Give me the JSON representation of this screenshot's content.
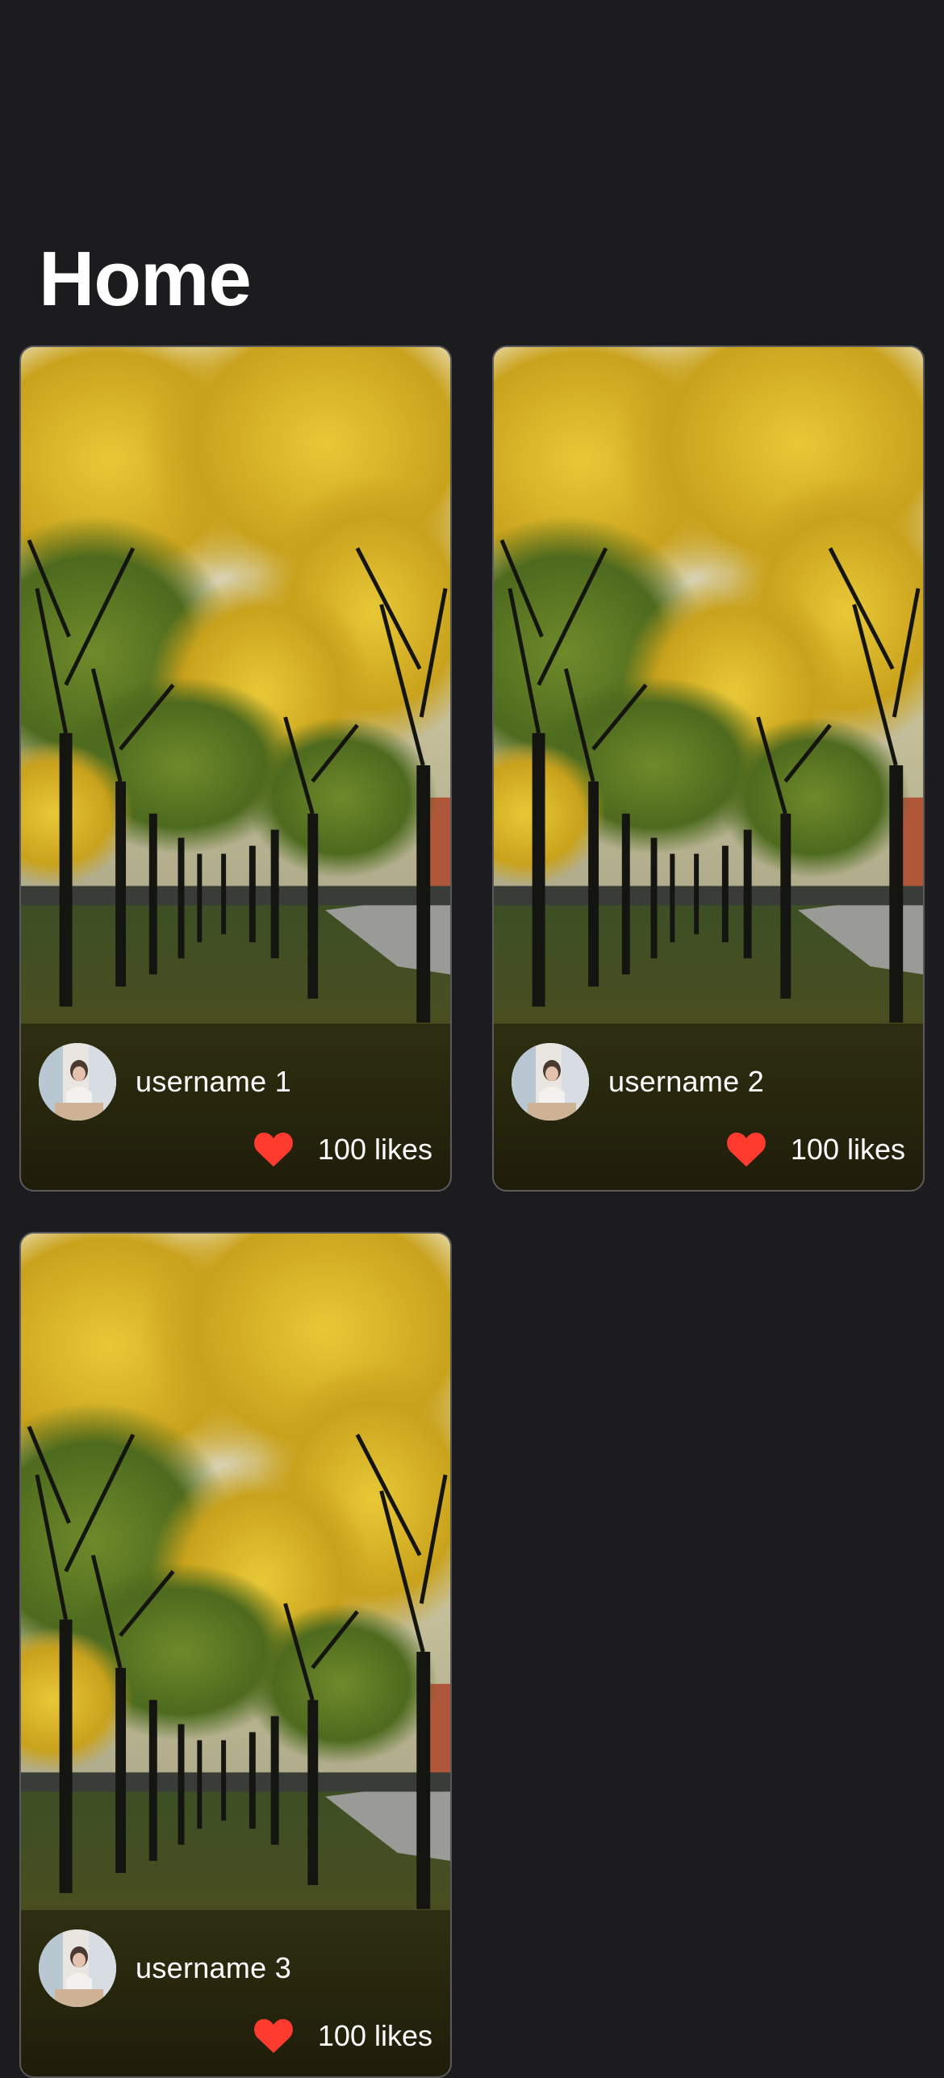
{
  "page": {
    "title": "Home"
  },
  "colors": {
    "background": "#1c1c1e",
    "card_border": "#5a5a5e",
    "heart": "#ff3b30",
    "text": "#ffffff"
  },
  "icons": {
    "like": "heart-icon",
    "avatar": "avatar-photo"
  },
  "posts": [
    {
      "username": "username 1",
      "likes": "100 likes"
    },
    {
      "username": "username 2",
      "likes": "100 likes"
    },
    {
      "username": "username 3",
      "likes": "100 likes"
    }
  ]
}
